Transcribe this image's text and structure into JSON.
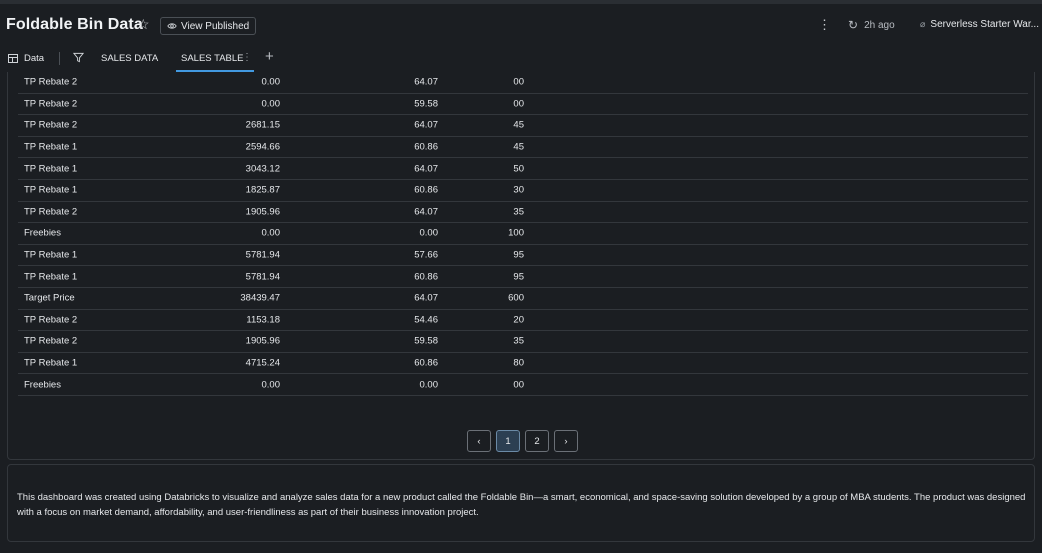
{
  "header": {
    "title": "Foldable Bin Data",
    "view_published_label": "View Published",
    "refresh_time": "2h ago",
    "warehouse_label": "Serverless Starter War..."
  },
  "tabs": {
    "data_label": "Data",
    "items": [
      {
        "label": "SALES DATA",
        "active": false
      },
      {
        "label": "SALES TABLE",
        "active": true
      }
    ]
  },
  "table": {
    "rows": [
      [
        "TP Rebate 2",
        "0.00",
        "64.07",
        "00"
      ],
      [
        "TP Rebate 2",
        "0.00",
        "59.58",
        "00"
      ],
      [
        "TP Rebate 2",
        "2681.15",
        "64.07",
        "45"
      ],
      [
        "TP Rebate 1",
        "2594.66",
        "60.86",
        "45"
      ],
      [
        "TP Rebate 1",
        "3043.12",
        "64.07",
        "50"
      ],
      [
        "TP Rebate 1",
        "1825.87",
        "60.86",
        "30"
      ],
      [
        "TP Rebate 2",
        "1905.96",
        "64.07",
        "35"
      ],
      [
        "Freebies",
        "0.00",
        "0.00",
        "100"
      ],
      [
        "TP Rebate 1",
        "5781.94",
        "57.66",
        "95"
      ],
      [
        "TP Rebate 1",
        "5781.94",
        "60.86",
        "95"
      ],
      [
        "Target Price",
        "38439.47",
        "64.07",
        "600"
      ],
      [
        "TP Rebate 2",
        "1153.18",
        "54.46",
        "20"
      ],
      [
        "TP Rebate 2",
        "1905.96",
        "59.58",
        "35"
      ],
      [
        "TP Rebate 1",
        "4715.24",
        "60.86",
        "80"
      ],
      [
        "Freebies",
        "0.00",
        "0.00",
        "00"
      ]
    ]
  },
  "pagination": {
    "pages": [
      "1",
      "2"
    ],
    "current": "1"
  },
  "description": "This dashboard was created using Databricks to visualize and analyze sales data for a new product called the Foldable Bin—a smart, economical, and space-saving solution developed by a group of MBA students. The product was designed with a focus on market demand, affordability, and user-friendliness as part of their business innovation project.",
  "colors": {
    "background": "#1b1e22",
    "accent": "#4299e0",
    "border": "#33373c"
  }
}
